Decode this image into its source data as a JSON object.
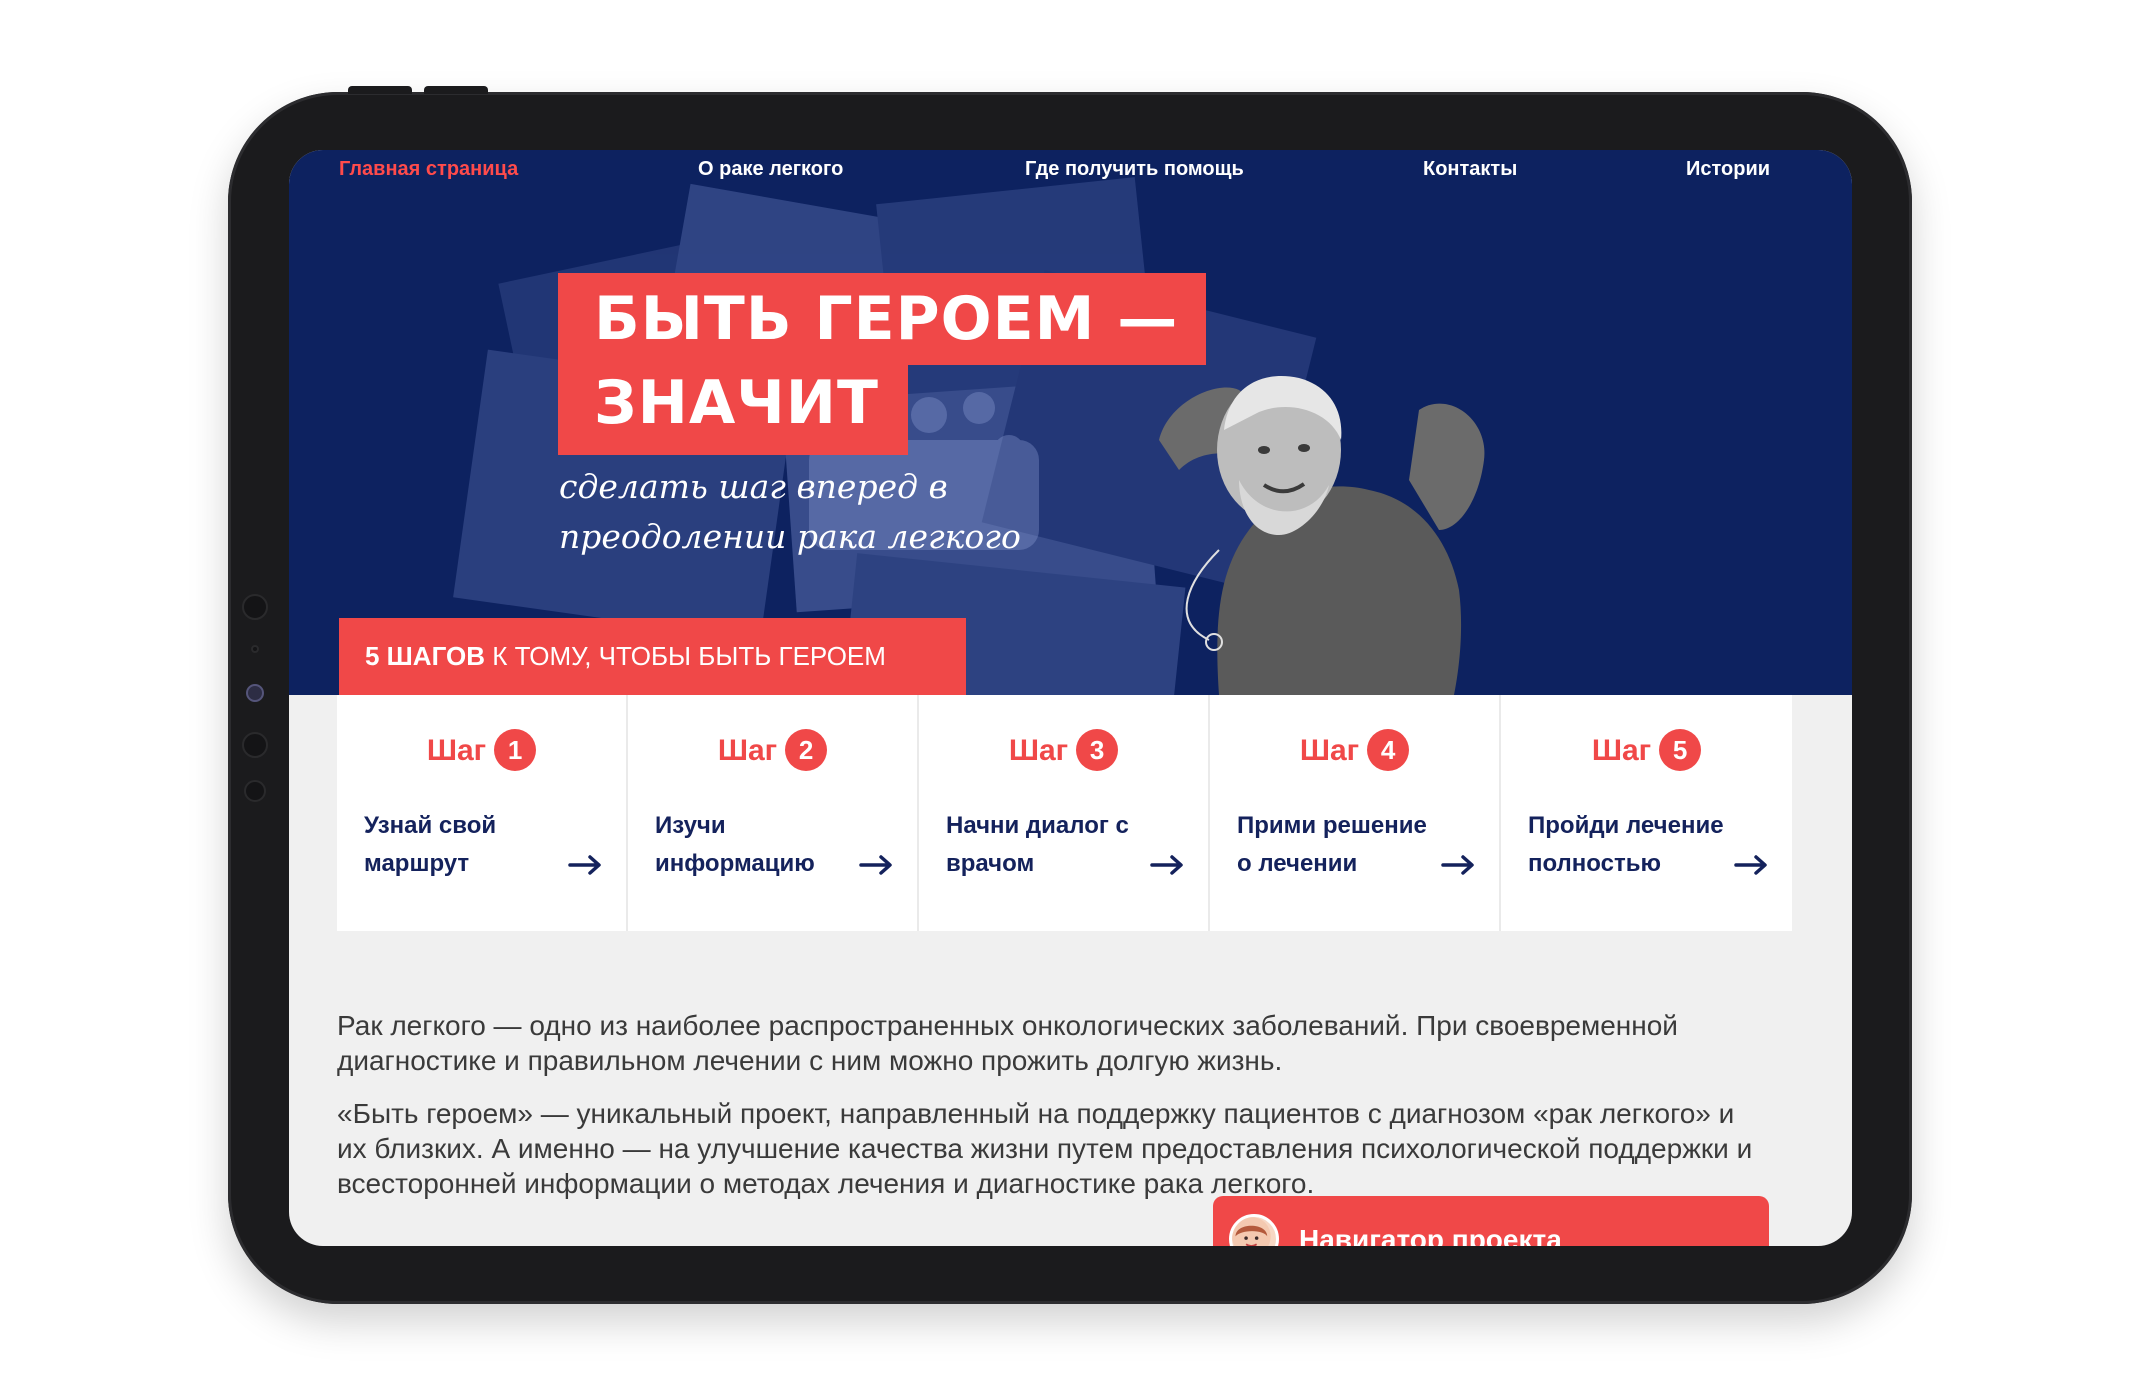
{
  "nav": {
    "items": [
      {
        "label": "Главная страница",
        "active": true
      },
      {
        "label": "О раке легкого",
        "active": false
      },
      {
        "label": "Где получить помощь",
        "active": false
      },
      {
        "label": "Контакты",
        "active": false
      },
      {
        "label": "Истории",
        "active": false
      }
    ]
  },
  "hero": {
    "headline_line1": "БЫТЬ ГЕРОЕМ —",
    "headline_line2": "ЗНАЧИТ",
    "subtitle": "сделать шаг вперед в преодолении рака легкого",
    "banner_bold": "5 ШАГОВ",
    "banner_rest": " К ТОМУ, ЧТОБЫ БЫТЬ ГЕРОЕМ"
  },
  "steps": [
    {
      "word": "Шаг",
      "num": "1",
      "text": "Узнай свой маршрут"
    },
    {
      "word": "Шаг",
      "num": "2",
      "text": "Изучи информацию"
    },
    {
      "word": "Шаг",
      "num": "3",
      "text": "Начни диалог с врачом"
    },
    {
      "word": "Шаг",
      "num": "4",
      "text": "Прими решение о лечении"
    },
    {
      "word": "Шаг",
      "num": "5",
      "text": "Пройди лечение полностью"
    }
  ],
  "about": {
    "p1": "Рак легкого — одно из наиболее распространенных онкологических заболеваний. При своевременной диагностике и правильном лечении с ним можно прожить долгую жизнь.",
    "p2": "«Быть героем» — уникальный проект, направленный на поддержку пациентов с диагнозом «рак легкого» и их близких. А именно — на улучшение качества жизни путем предоставления психологической поддержки и всесторонней информации о методах лечения и диагностике рака легкого."
  },
  "navigator": {
    "label": "Навигатор проекта"
  },
  "colors": {
    "navy": "#0d2260",
    "accent": "#f04848",
    "text_dark": "#14225c"
  }
}
